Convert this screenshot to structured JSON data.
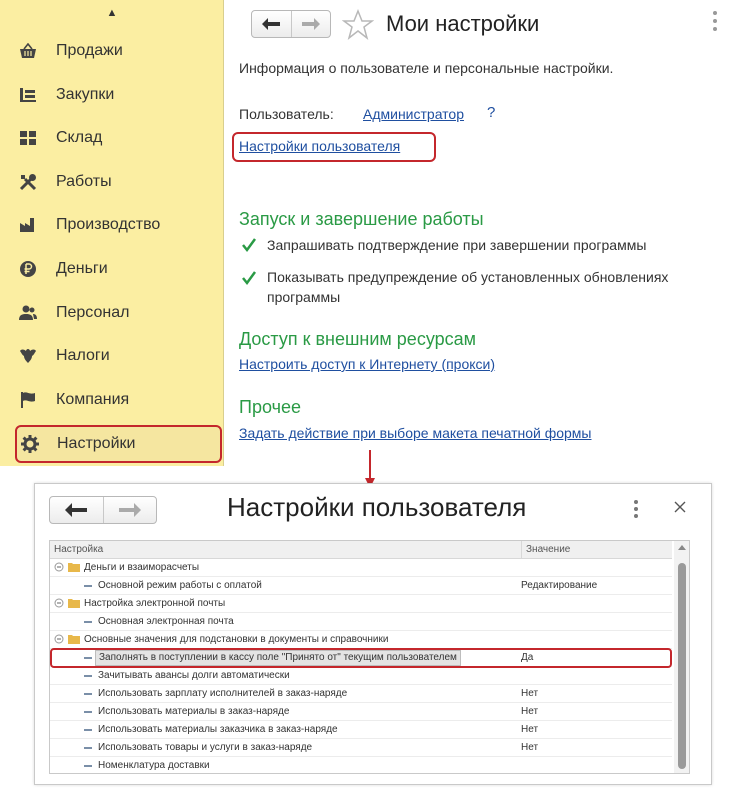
{
  "sidebar": {
    "items": [
      {
        "label": "Продажи",
        "icon": "basket-icon"
      },
      {
        "label": "Закупки",
        "icon": "purchases-icon"
      },
      {
        "label": "Склад",
        "icon": "warehouse-icon"
      },
      {
        "label": "Работы",
        "icon": "tools-icon"
      },
      {
        "label": "Производство",
        "icon": "factory-icon"
      },
      {
        "label": "Деньги",
        "icon": "ruble-icon"
      },
      {
        "label": "Персонал",
        "icon": "people-icon"
      },
      {
        "label": "Налоги",
        "icon": "eagle-icon"
      },
      {
        "label": "Компания",
        "icon": "flag-icon"
      },
      {
        "label": "Настройки",
        "icon": "gear-icon"
      }
    ]
  },
  "main": {
    "title": "Мои настройки",
    "info": "Информация о пользователе и персональные настройки.",
    "user_label": "Пользователь:",
    "user_link": "Администратор",
    "help": "?",
    "settings_link": "Настройки пользователя",
    "section_startup": "Запуск и завершение работы",
    "checkbox_exit_confirm": "Запрашивать подтверждение при завершении программы",
    "checkbox_updates_warn": "Показывать предупреждение об установленных обновлениях программы",
    "section_external": "Доступ к внешним ресурсам",
    "proxy_link": "Настроить доступ к Интернету (прокси)",
    "section_other": "Прочее",
    "print_link": "Задать действие при выборе макета печатной формы"
  },
  "dialog": {
    "title": "Настройки пользователя",
    "col_setting": "Настройка",
    "col_value": "Значение",
    "rows": [
      {
        "kind": "group",
        "text": "Деньги и взаиморасчеты",
        "value": ""
      },
      {
        "kind": "leaf",
        "text": "Основной режим работы с оплатой",
        "value": "Редактирование"
      },
      {
        "kind": "group",
        "text": "Настройка электронной почты",
        "value": ""
      },
      {
        "kind": "leaf",
        "text": "Основная электронная почта",
        "value": ""
      },
      {
        "kind": "group",
        "text": "Основные значения для подстановки в документы и справочники",
        "value": ""
      },
      {
        "kind": "leaf",
        "text": "Заполнять в поступлении в кассу поле \"Принято от\" текущим пользователем",
        "value": "Да",
        "selected": true
      },
      {
        "kind": "leaf",
        "text": "Зачитывать авансы долги автоматически",
        "value": ""
      },
      {
        "kind": "leaf",
        "text": "Использовать зарплату исполнителей в заказ-наряде",
        "value": "Нет"
      },
      {
        "kind": "leaf",
        "text": "Использовать материалы в заказ-наряде",
        "value": "Нет"
      },
      {
        "kind": "leaf",
        "text": "Использовать материалы заказчика в заказ-наряде",
        "value": "Нет"
      },
      {
        "kind": "leaf",
        "text": "Использовать товары и услуги в заказ-наряде",
        "value": "Нет"
      },
      {
        "kind": "leaf",
        "text": "Номенклатура доставки",
        "value": ""
      }
    ]
  },
  "colors": {
    "sidebar_bg": "#fbeea2",
    "highlight": "#c4272c",
    "link": "#1f4fa0",
    "section": "#2a9a45",
    "check": "#2a9a45"
  }
}
